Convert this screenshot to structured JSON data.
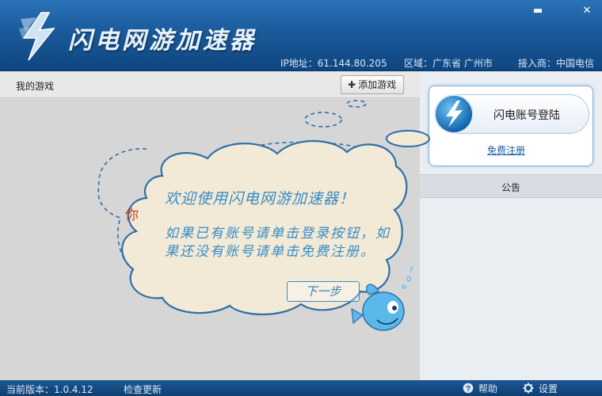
{
  "window": {
    "title": "闪电网游加速器",
    "minimize_icon": "minimize-icon",
    "close_icon": "close-icon",
    "minimize_glyph": "▬",
    "close_glyph": "✕"
  },
  "status": {
    "ip_label": "IP地址：",
    "ip_value": "61.144.80.205",
    "region_label": "区域：",
    "region_value": "广东省 广州市",
    "isp_label": "接入商：",
    "isp_value": "中国电信"
  },
  "games": {
    "title": "我的游戏",
    "add_button": "添加游戏",
    "add_button_icon": "plus-icon",
    "add_button_glyph": "✚"
  },
  "account": {
    "login_button": "闪电账号登陆",
    "register_link": "免费注册"
  },
  "notice": {
    "title": "公告"
  },
  "tutorial": {
    "title": "欢迎使用闪电网游加速器！",
    "body": "如果已有账号请单击登录按钮，如果还没有账号请单击免费注册。",
    "next_button": "下一步",
    "hint_partial": "你"
  },
  "footer": {
    "version_label": "当前版本：",
    "version_value": "1.0.4.12",
    "check_update": "检查更新",
    "help": "帮助",
    "settings": "设置"
  },
  "colors": {
    "header": "#1a5a9a",
    "accent": "#3a8cc4",
    "bubble_fill": "#f2ead6",
    "bubble_stroke": "#2f6fa8",
    "link": "#1c5ea8"
  }
}
